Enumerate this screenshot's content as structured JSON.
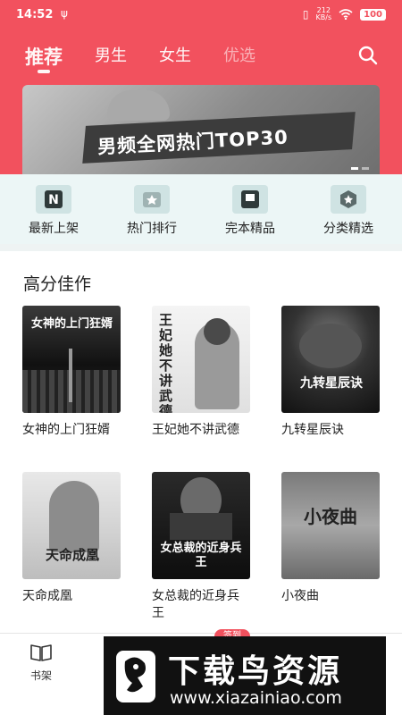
{
  "status": {
    "time": "14:52",
    "usb_icon": "usb-icon",
    "speed_value": "212",
    "speed_unit": "KB/s",
    "battery": "100"
  },
  "tabs": [
    {
      "label": "推荐",
      "active": true
    },
    {
      "label": "男生"
    },
    {
      "label": "女生"
    },
    {
      "label": "优选"
    }
  ],
  "banner": {
    "title": "男频全网热门TOP30"
  },
  "quick": [
    {
      "label": "最新上架",
      "icon": "new-shelf-icon"
    },
    {
      "label": "热门排行",
      "icon": "hot-rank-icon"
    },
    {
      "label": "完本精品",
      "icon": "finished-book-icon"
    },
    {
      "label": "分类精选",
      "icon": "category-icon"
    }
  ],
  "section": {
    "title": "高分佳作",
    "books": [
      {
        "title": "女神的上门狂婿",
        "cover_text": "女神的上门狂婿"
      },
      {
        "title": "王妃她不讲武德",
        "cover_text": "王妃她不讲武德"
      },
      {
        "title": "九转星辰诀",
        "cover_text": "九转星辰诀"
      },
      {
        "title": "天命成凰",
        "cover_text": "天命成凰"
      },
      {
        "title": "女总裁的近身兵王",
        "cover_text": "女总裁的近身兵王"
      },
      {
        "title": "小夜曲",
        "cover_text": "小夜曲"
      }
    ]
  },
  "bottom_nav": {
    "shelf_label": "书架",
    "signin_badge": "签到"
  },
  "watermark": {
    "title": "下载鸟资源",
    "url": "www.xiazainiao.com"
  }
}
